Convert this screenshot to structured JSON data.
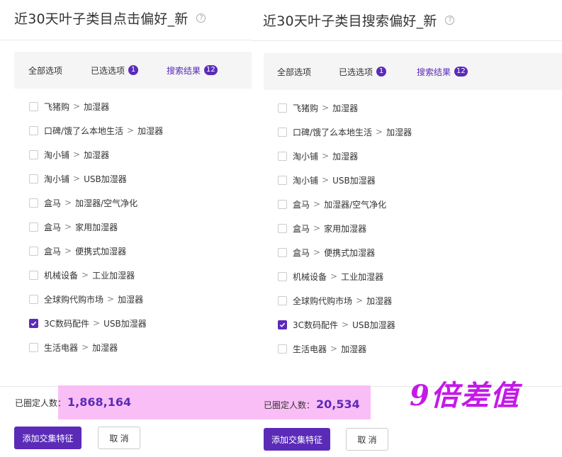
{
  "left": {
    "title": "近30天叶子类目点击偏好_新",
    "help_icon": "?",
    "tabs": [
      {
        "label": "全部选项",
        "badge": null,
        "active": false
      },
      {
        "label": "已选选项",
        "badge": "1",
        "active": false
      },
      {
        "label": "搜索结果",
        "badge": "12",
        "active": true
      }
    ],
    "separator": ">",
    "items": [
      {
        "parent": "飞猪购",
        "child": "加湿器",
        "checked": false
      },
      {
        "parent": "口碑/饿了么本地生活",
        "child": "加湿器",
        "checked": false
      },
      {
        "parent": "淘小铺",
        "child": "加湿器",
        "checked": false
      },
      {
        "parent": "淘小铺",
        "child": "USB加湿器",
        "checked": false
      },
      {
        "parent": "盒马",
        "child": "加湿器/空气净化",
        "checked": false
      },
      {
        "parent": "盒马",
        "child": "家用加湿器",
        "checked": false
      },
      {
        "parent": "盒马",
        "child": "便携式加湿器",
        "checked": false
      },
      {
        "parent": "机械设备",
        "child": "工业加湿器",
        "checked": false
      },
      {
        "parent": "全球购代购市场",
        "child": "加湿器",
        "checked": false
      },
      {
        "parent": "3C数码配件",
        "child": "USB加湿器",
        "checked": true
      },
      {
        "parent": "生活电器",
        "child": "加湿器",
        "checked": false
      }
    ],
    "count_label": "已圈定人数：",
    "count_value": "1,868,164",
    "add_button": "添加交集特征",
    "cancel_button": "取 消"
  },
  "right": {
    "title": "近30天叶子类目搜索偏好_新",
    "help_icon": "?",
    "tabs": [
      {
        "label": "全部选项",
        "badge": null,
        "active": false
      },
      {
        "label": "已选选项",
        "badge": "1",
        "active": false
      },
      {
        "label": "搜索结果",
        "badge": "12",
        "active": true
      }
    ],
    "separator": ">",
    "items": [
      {
        "parent": "飞猪购",
        "child": "加湿器",
        "checked": false
      },
      {
        "parent": "口碑/饿了么本地生活",
        "child": "加湿器",
        "checked": false
      },
      {
        "parent": "淘小铺",
        "child": "加湿器",
        "checked": false
      },
      {
        "parent": "淘小铺",
        "child": "USB加湿器",
        "checked": false
      },
      {
        "parent": "盒马",
        "child": "加湿器/空气净化",
        "checked": false
      },
      {
        "parent": "盒马",
        "child": "家用加湿器",
        "checked": false
      },
      {
        "parent": "盒马",
        "child": "便携式加湿器",
        "checked": false
      },
      {
        "parent": "机械设备",
        "child": "工业加湿器",
        "checked": false
      },
      {
        "parent": "全球购代购市场",
        "child": "加湿器",
        "checked": false
      },
      {
        "parent": "3C数码配件",
        "child": "USB加湿器",
        "checked": true
      },
      {
        "parent": "生活电器",
        "child": "加湿器",
        "checked": false
      }
    ],
    "count_label": "已圈定人数：",
    "count_value": "20,534",
    "add_button": "添加交集特征",
    "cancel_button": "取 消"
  },
  "annotation": "9倍差值",
  "colors": {
    "accent": "#5b2bb8",
    "highlight": "#f9b3f5",
    "annotation": "#c419e8"
  }
}
